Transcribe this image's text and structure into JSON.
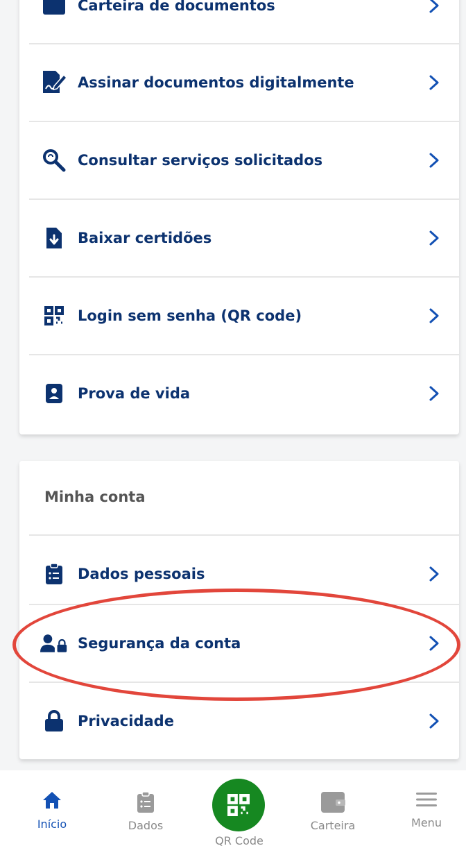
{
  "services": [
    {
      "label": "Carteira de documentos",
      "icon": "wallet-icon"
    },
    {
      "label": "Assinar documentos digitalmente",
      "icon": "sign-document-icon"
    },
    {
      "label": "Consultar serviços solicitados",
      "icon": "search-services-icon"
    },
    {
      "label": "Baixar certidões",
      "icon": "download-file-icon"
    },
    {
      "label": "Login sem senha (QR code)",
      "icon": "qr-code-icon"
    },
    {
      "label": "Prova de vida",
      "icon": "id-badge-icon"
    }
  ],
  "account": {
    "title": "Minha conta",
    "items": [
      {
        "label": "Dados pessoais",
        "icon": "clipboard-list-icon"
      },
      {
        "label": "Segurança da conta",
        "icon": "user-lock-icon"
      },
      {
        "label": "Privacidade",
        "icon": "lock-icon"
      }
    ]
  },
  "bottom_nav": {
    "home": "Início",
    "data": "Dados",
    "qr": "QR Code",
    "wallet": "Carteira",
    "menu": "Menu"
  },
  "colors": {
    "primary_text": "#0c326f",
    "active_nav": "#1351b4",
    "green": "#168821",
    "highlight": "#e2463b"
  }
}
